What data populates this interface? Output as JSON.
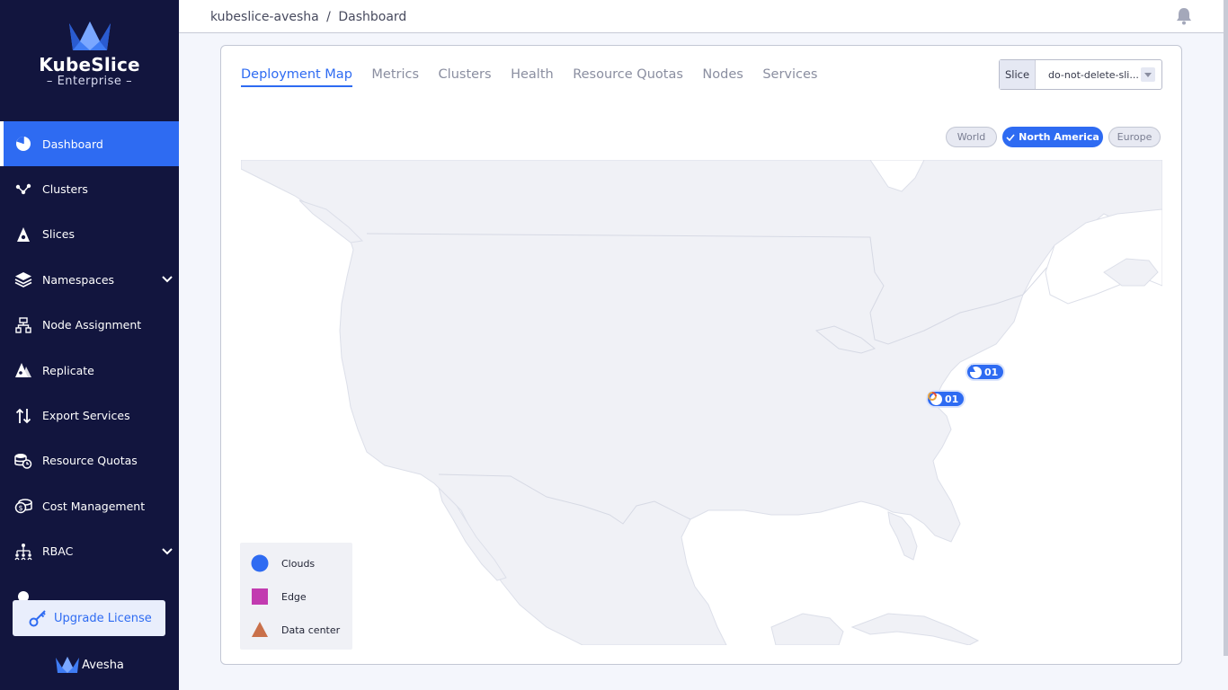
{
  "sidebar": {
    "brand_title": "KubeSlice",
    "brand_sub": "Enterprise",
    "items": [
      {
        "label": "Dashboard",
        "icon": "pie-chart-icon"
      },
      {
        "label": "Clusters",
        "icon": "cluster-nodes-icon"
      },
      {
        "label": "Slices",
        "icon": "slice-triangle-icon"
      },
      {
        "label": "Namespaces",
        "icon": "layers-icon"
      },
      {
        "label": "Node Assignment",
        "icon": "node-tree-icon"
      },
      {
        "label": "Replicate",
        "icon": "replicate-icon"
      },
      {
        "label": "Export Services",
        "icon": "arrows-up-down-icon"
      },
      {
        "label": "Resource Quotas",
        "icon": "quota-icon"
      },
      {
        "label": "Cost Management",
        "icon": "coins-icon"
      },
      {
        "label": "RBAC",
        "icon": "rbac-users-icon"
      }
    ],
    "upgrade_label": "Upgrade License",
    "footer_label": "Avesha"
  },
  "header": {
    "breadcrumb_root": "kubeslice-avesha",
    "breadcrumb_sep": "/",
    "breadcrumb_current": "Dashboard"
  },
  "tabs": [
    "Deployment Map",
    "Metrics",
    "Clusters",
    "Health",
    "Resource Quotas",
    "Nodes",
    "Services"
  ],
  "slice": {
    "label": "Slice",
    "value": "do-not-delete-sli..."
  },
  "regions": [
    {
      "label": "World",
      "selected": false
    },
    {
      "label": "North America",
      "selected": true
    },
    {
      "label": "Europe",
      "selected": false
    }
  ],
  "markers": [
    {
      "label": "01",
      "icon": "cloud-provider-a-icon"
    },
    {
      "label": "01",
      "icon": "cloud-provider-b-icon"
    }
  ],
  "legend": [
    {
      "label": "Clouds",
      "color": "#2e6bf2",
      "shape": "circle"
    },
    {
      "label": "Edge",
      "color": "#c23bb0",
      "shape": "square"
    },
    {
      "label": "Data center",
      "color": "#c9704a",
      "shape": "triangle"
    }
  ],
  "colors": {
    "accent": "#2e6bf2",
    "sidebar": "#12153e",
    "land": "#f0f1f6"
  }
}
